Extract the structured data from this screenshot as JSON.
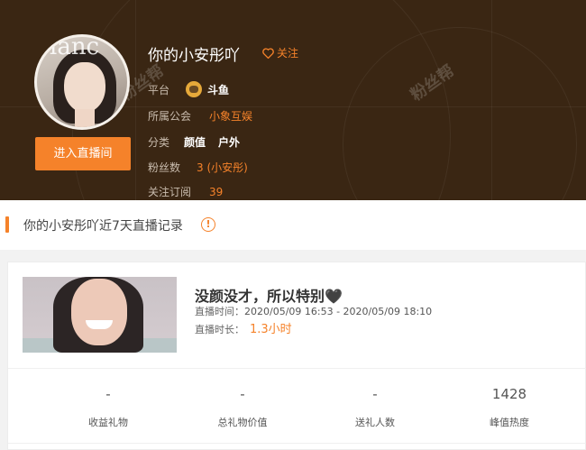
{
  "anchor": {
    "name": "你的小安彤吖",
    "follow_label": "关注",
    "enter_button": "进入直播间",
    "avatar_text": "lanc"
  },
  "info": {
    "platform_label": "平台",
    "platform_value": "斗鱼",
    "guild_label": "所属公会",
    "guild_value": "小象互娱",
    "category_label": "分类",
    "categories": [
      "颜值",
      "户外"
    ],
    "fans_label": "粉丝数",
    "fans_value": "3 (小安彤)",
    "subs_label": "关注订阅",
    "subs_value": "39"
  },
  "watermarks": [
    "粉丝帮",
    "粉丝帮"
  ],
  "section": {
    "title": "你的小安彤吖近7天直播记录",
    "info_icon": "!"
  },
  "record": {
    "title": "没颜没才，所以特别🖤",
    "time_label": "直播时间：",
    "time_value": "2020/05/09 16:53 - 2020/05/09 18:10",
    "duration_label": "直播时长：",
    "duration_value": "1.3小时"
  },
  "stats": [
    {
      "value": "-",
      "label": "收益礼物"
    },
    {
      "value": "-",
      "label": "总礼物价值"
    },
    {
      "value": "-",
      "label": "送礼人数"
    },
    {
      "value": "1428",
      "label": "峰值热度"
    }
  ],
  "colors": {
    "accent": "#f5822a",
    "header_bg": "#3a2613"
  }
}
